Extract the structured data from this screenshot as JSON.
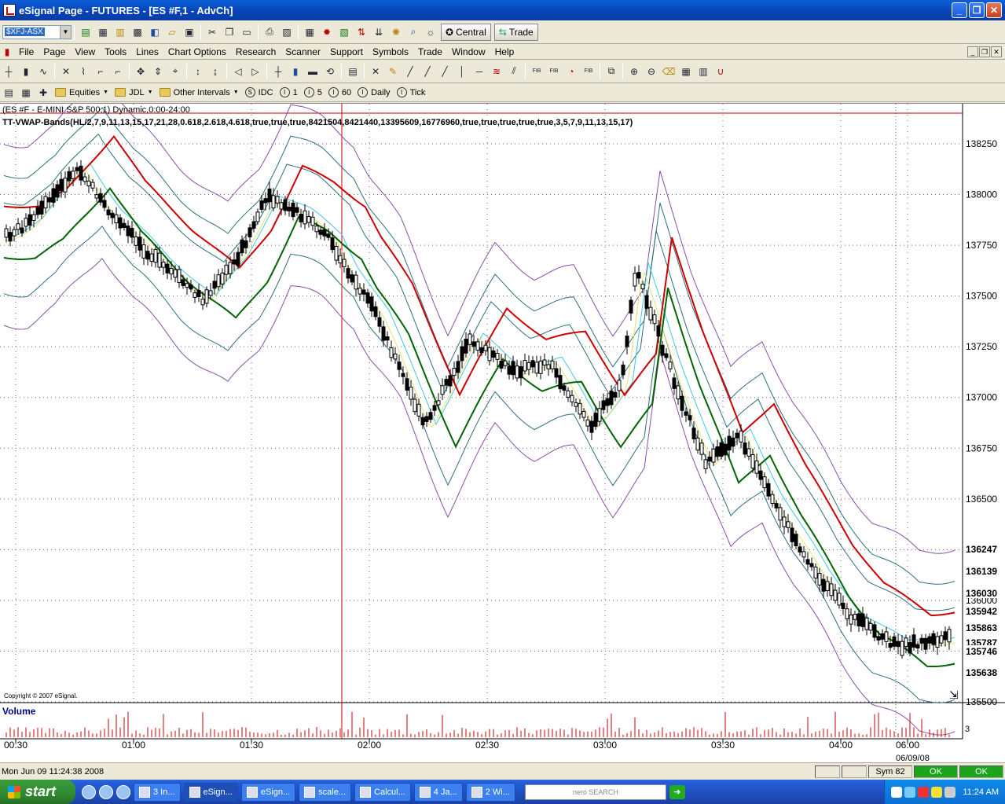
{
  "window": {
    "title": "eSignal Page - FUTURES - [ES #F,1 - AdvCh]"
  },
  "toolbar": {
    "symbol_value": "$XFJ-ASX",
    "central_label": "Central",
    "trade_label": "Trade"
  },
  "menu": {
    "items": [
      "File",
      "Page",
      "View",
      "Tools",
      "Lines",
      "Chart Options",
      "Research",
      "Scanner",
      "Support",
      "Symbols",
      "Trade",
      "Window",
      "Help"
    ]
  },
  "intervals": {
    "equities": "Equities",
    "jdl": "JDL",
    "other": "Other Intervals",
    "idc": "IDC",
    "i1": "1",
    "i5": "5",
    "i60": "60",
    "daily": "Daily",
    "tick": "Tick",
    "s_icon": "S",
    "i_icon": "I"
  },
  "chart": {
    "title": "(ES #F - E-MINI S&P 500,1) Dynamic,0:00-24:00",
    "study": "TT-VWAP-Bands(HL/2,7,9,11,13,15,17,21,28,0.618,2.618,4.618,true,true,true,8421504,8421440,13395609,16776960,true,true,true,true,true,3,5,7,9,11,13,15,17)",
    "copyright": "Copyright © 2007 eSignal.",
    "volume_label": "Volume",
    "volume_scale": "3",
    "date_label": "06/09/08"
  },
  "chart_data": {
    "type": "line",
    "y_ticks": [
      138250,
      138000,
      137750,
      137500,
      137250,
      137000,
      136750,
      136500,
      136250,
      136000,
      135750,
      135500
    ],
    "x_ticks": [
      "00:30",
      "01:00",
      "01:30",
      "02:00",
      "02:30",
      "03:00",
      "03:30",
      "04:00",
      "06:00"
    ],
    "price_tags": [
      "136247",
      "136139",
      "136030",
      "135942",
      "135863",
      "135787",
      "135746",
      "135638"
    ]
  },
  "status": {
    "datetime": "Mon Jun 09 11:24:38 2008",
    "sym": "Sym 82",
    "ok1": "OK",
    "ok2": "OK"
  },
  "taskbar": {
    "start": "start",
    "tasks": [
      "3 In...",
      "eSign...",
      "eSign...",
      "scale...",
      "Calcul...",
      "4 Ja...",
      "2 Wi..."
    ],
    "search": "nero SEARCH",
    "clock": "11:24 AM"
  },
  "colors": {
    "vwap_red": "#CC0000",
    "vwap_green": "#006400",
    "band_yellow": "#E8E070",
    "band_cyan": "#40C8E0",
    "band_teal": "#2F6F7F",
    "band_purple": "#8A4FA8"
  }
}
